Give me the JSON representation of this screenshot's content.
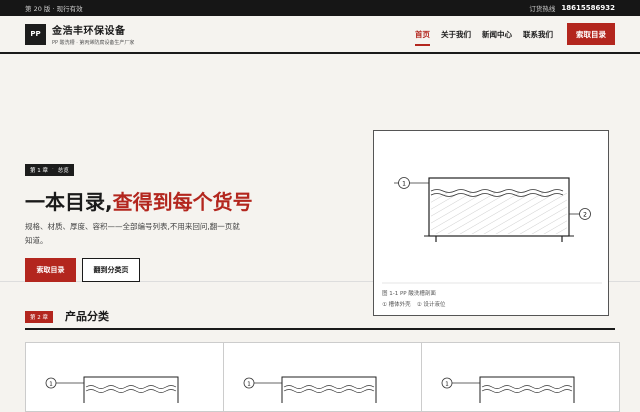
{
  "topbar": {
    "edition": "第 20 版 · 现行有效",
    "hotline_label": "订货热线",
    "hotline_number": "18615586932"
  },
  "header": {
    "logo_text": "PP",
    "brand_name": "金浩丰环保设备",
    "brand_sub": "PP 酸洗槽 · 第丙烯防腐设备生产厂家",
    "nav": [
      {
        "label": "首页",
        "active": true
      },
      {
        "label": "关于我们",
        "active": false
      },
      {
        "label": "新闻中心",
        "active": false
      },
      {
        "label": "联系我们",
        "active": false
      }
    ],
    "cta_label": "索取目录"
  },
  "hero": {
    "chapter_chip": [
      "第 1 章",
      "·",
      "总览"
    ],
    "headline_black": "一本目录,",
    "headline_red": "查得到每个货号",
    "description": "规格、材质、厚度、容积——全部编号列表,不用来回问,翻一页就知道。",
    "primary_button": "索取目录",
    "secondary_button": "翻到分类页",
    "figure": {
      "caption": "图 1-1 PP 酸洗槽剖面",
      "legend": [
        "① 槽体外壳",
        "② 设计液位"
      ],
      "callout_1": "1",
      "callout_2": "2"
    }
  },
  "section2": {
    "chapter_chip": [
      "第 2 章"
    ],
    "title": "产品分类",
    "cards": [
      {
        "callout": "1"
      },
      {
        "callout": "1"
      },
      {
        "callout": "1"
      }
    ]
  },
  "colors": {
    "accent": "#b3261e",
    "dark": "#1c1c1c",
    "background": "#f5f3ef"
  }
}
